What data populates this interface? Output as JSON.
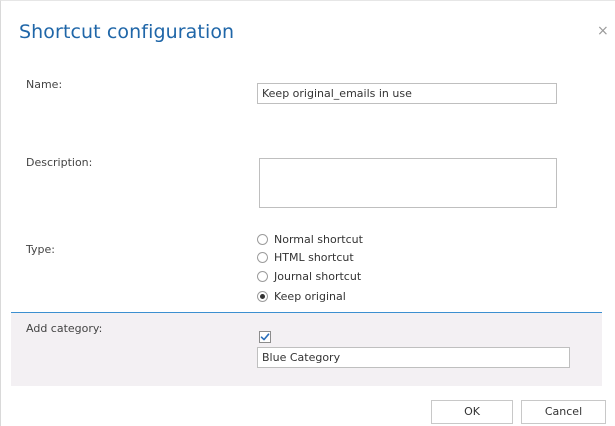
{
  "dialog": {
    "title": "Shortcut configuration",
    "close_glyph": "×"
  },
  "fields": {
    "name": {
      "label": "Name:",
      "value": "Keep original_emails in use"
    },
    "description": {
      "label": "Description:",
      "value": ""
    },
    "type": {
      "label": "Type:",
      "options": [
        {
          "label": "Normal shortcut",
          "selected": false
        },
        {
          "label": "HTML shortcut",
          "selected": false
        },
        {
          "label": "Journal shortcut",
          "selected": false
        },
        {
          "label": "Keep original",
          "selected": true
        }
      ]
    },
    "category": {
      "label": "Add category:",
      "checked": true,
      "value": "Blue Category"
    }
  },
  "buttons": {
    "ok_label": "OK",
    "cancel_label": "Cancel"
  },
  "colors": {
    "title": "#1f66a8",
    "divider": "#3c8fd0",
    "category_panel": "#f3f0f3",
    "checkmark": "#2a6ebb"
  },
  "icons": {
    "close": "close-icon",
    "check": "checkmark-icon"
  }
}
